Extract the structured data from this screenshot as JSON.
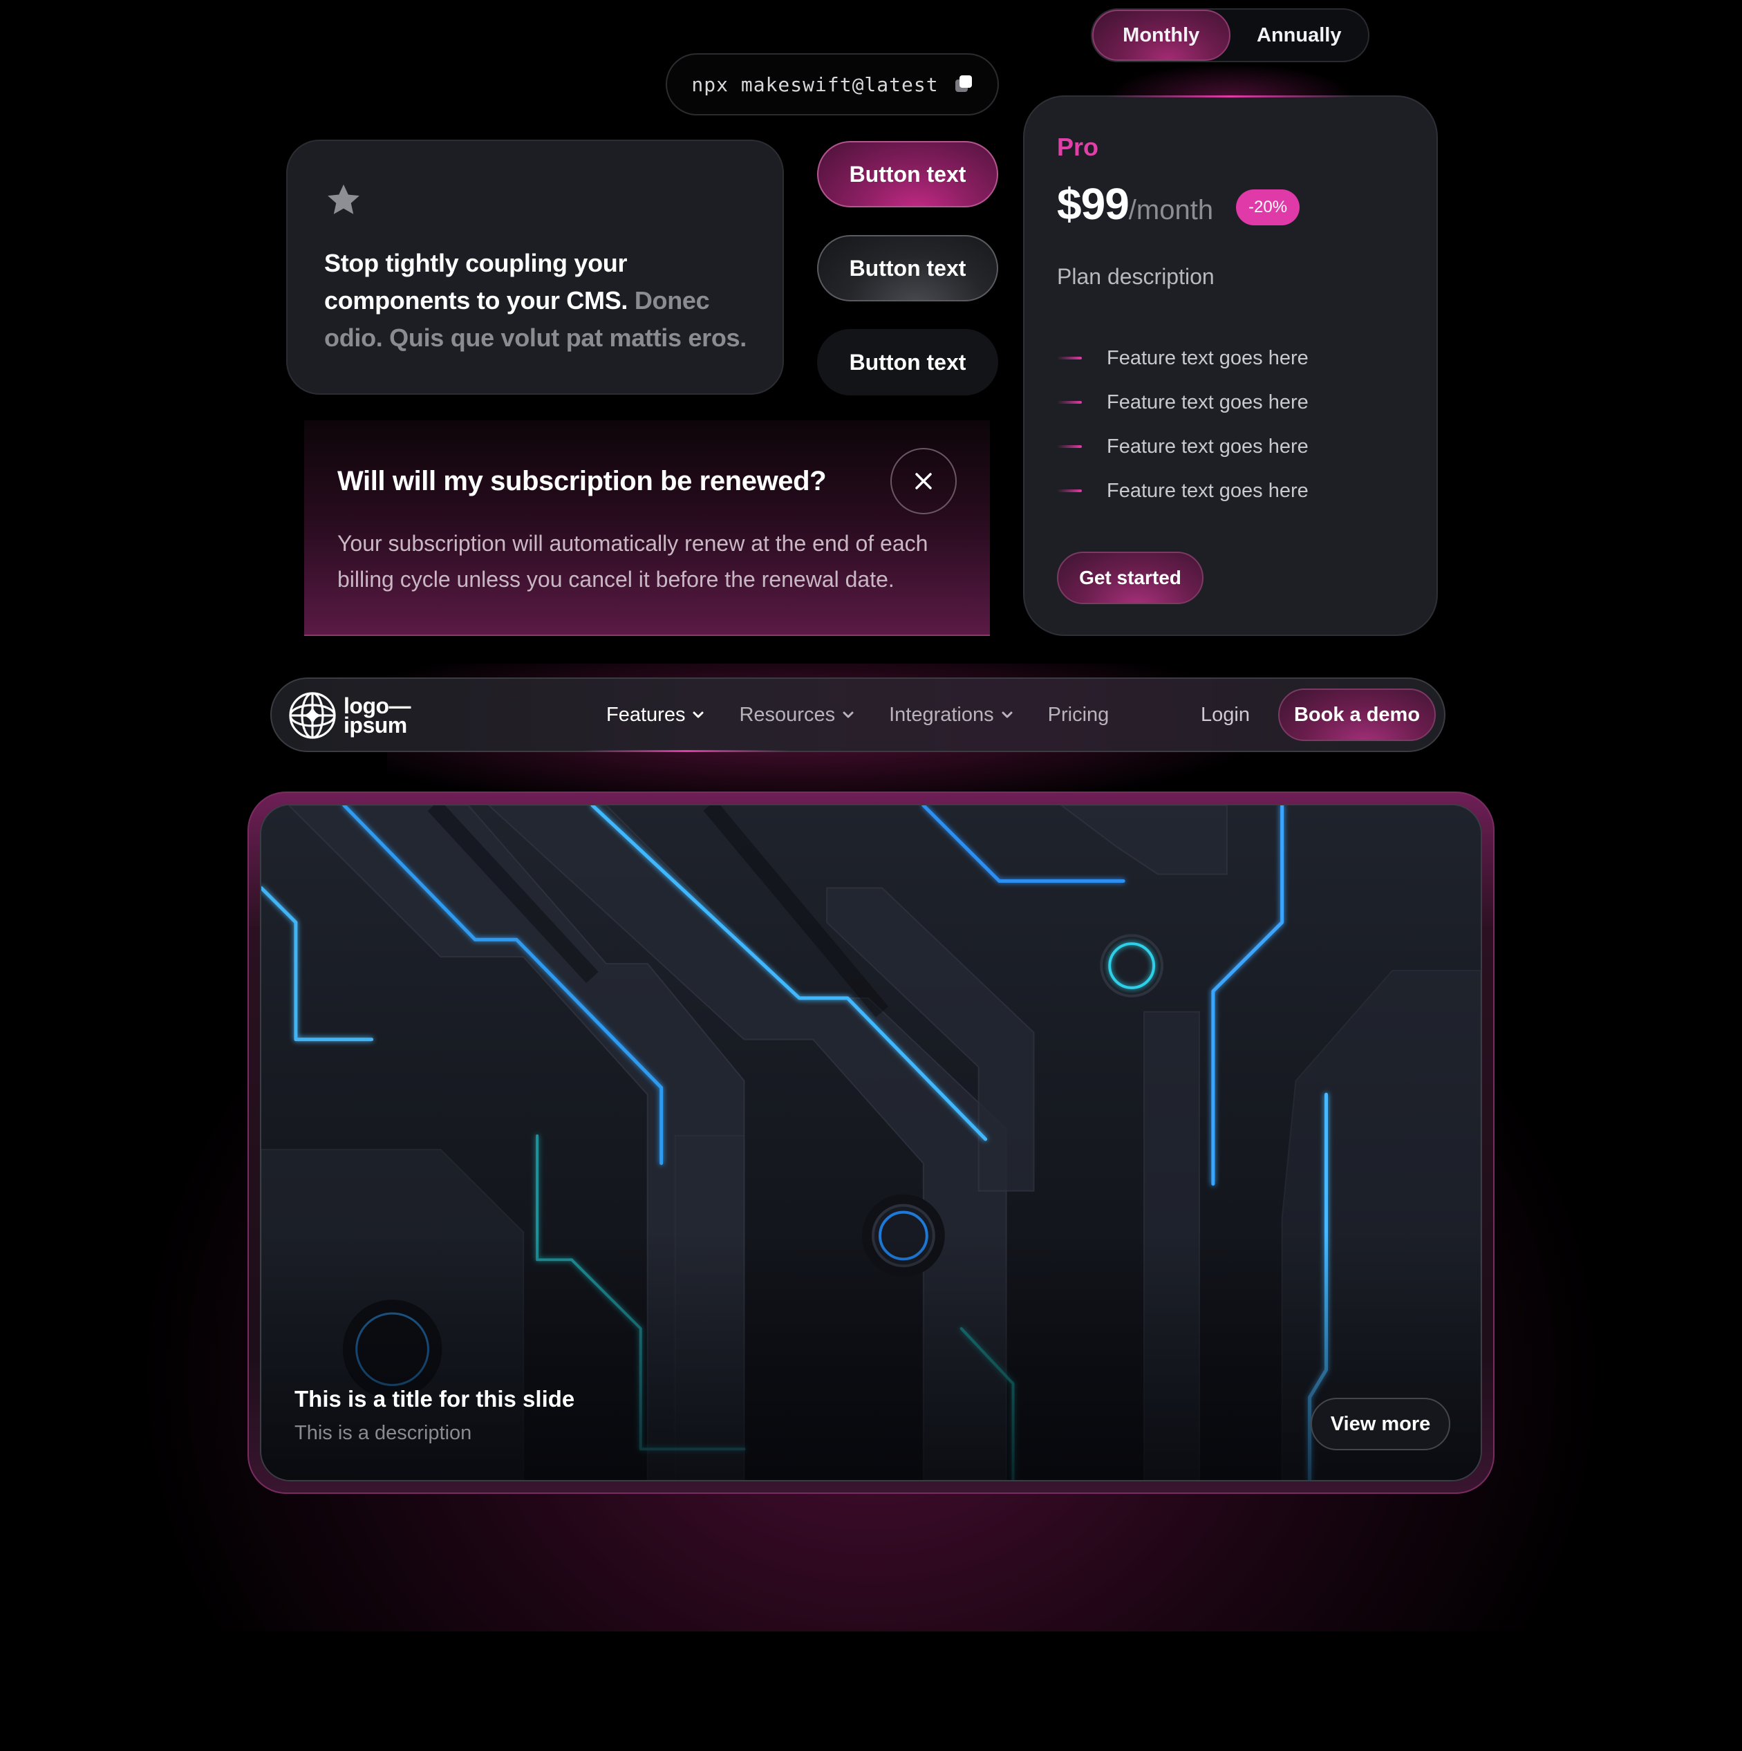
{
  "billing_toggle": {
    "options": [
      "Monthly",
      "Annually"
    ],
    "selected": "Monthly"
  },
  "command": {
    "text": "npx makeswift@latest",
    "icon": "copy-icon"
  },
  "testimonial": {
    "icon": "star-icon",
    "text_strong": "Stop tightly coupling your components to your CMS.",
    "text_muted": " Donec odio. Quis que volut pat mattis eros."
  },
  "buttons": {
    "primary_label": "Button text",
    "secondary_label": "Button text",
    "tertiary_label": "Button text"
  },
  "faq": {
    "question": "Will will my subscription be renewed?",
    "answer": "Your subscription will automatically renew at the end of each billing cycle unless you cancel it before the renewal date.",
    "close_icon": "close-icon"
  },
  "pricing": {
    "plan_name": "Pro",
    "price": "$99",
    "period": "/month",
    "discount_badge": "-20%",
    "description": "Plan description",
    "features": [
      "Feature text goes here",
      "Feature text goes here",
      "Feature text goes here",
      "Feature text goes here"
    ],
    "cta_label": "Get started"
  },
  "navbar": {
    "logo_line1": "logo—",
    "logo_line2": "ipsum",
    "links": [
      {
        "label": "Features",
        "dropdown": true
      },
      {
        "label": "Resources",
        "dropdown": true
      },
      {
        "label": "Integrations",
        "dropdown": true
      },
      {
        "label": "Pricing",
        "dropdown": false
      }
    ],
    "login_label": "Login",
    "cta_label": "Book a demo"
  },
  "slide": {
    "title": "This is a title for this slide",
    "description": "This is a description",
    "button_label": "View more"
  },
  "colors": {
    "accent_pink": "#e23ca8",
    "card_bg": "#1d1f25",
    "page_bg": "#000000",
    "circuit_blue": "#2fa8ff",
    "circuit_teal": "#1fc0c8"
  }
}
